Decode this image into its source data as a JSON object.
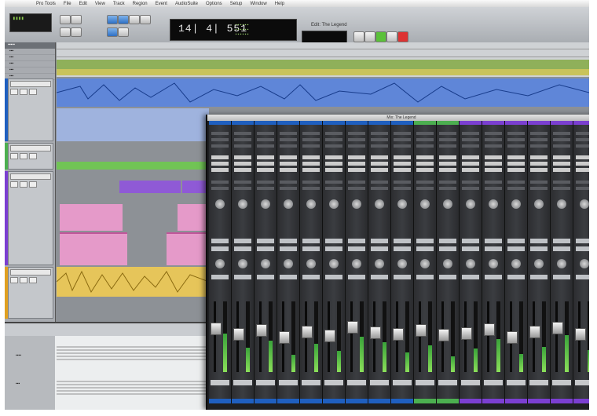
{
  "menu": [
    "Pro Tools",
    "File",
    "Edit",
    "View",
    "Track",
    "Region",
    "Event",
    "AudioSuite",
    "Options",
    "Setup",
    "Window",
    "Help"
  ],
  "toolbar": {
    "main_counter": "14| 4| 551",
    "window_title": "Edit: The Legend"
  },
  "mixer": {
    "title": "Mix: The Legend",
    "strips": [
      {
        "color": "#1f5fbf",
        "meter": 0.55,
        "fader": 0.62
      },
      {
        "color": "#1f5fbf",
        "meter": 0.35,
        "fader": 0.55
      },
      {
        "color": "#1f5fbf",
        "meter": 0.45,
        "fader": 0.6
      },
      {
        "color": "#1f5fbf",
        "meter": 0.25,
        "fader": 0.5
      },
      {
        "color": "#1f5fbf",
        "meter": 0.4,
        "fader": 0.58
      },
      {
        "color": "#1f5fbf",
        "meter": 0.3,
        "fader": 0.52
      },
      {
        "color": "#1f5fbf",
        "meter": 0.5,
        "fader": 0.64
      },
      {
        "color": "#1f5fbf",
        "meter": 0.42,
        "fader": 0.57
      },
      {
        "color": "#1f5fbf",
        "meter": 0.28,
        "fader": 0.55
      },
      {
        "color": "#4caf50",
        "meter": 0.38,
        "fader": 0.6
      },
      {
        "color": "#4caf50",
        "meter": 0.22,
        "fader": 0.53
      },
      {
        "color": "#7b3fd1",
        "meter": 0.33,
        "fader": 0.56
      },
      {
        "color": "#7b3fd1",
        "meter": 0.47,
        "fader": 0.61
      },
      {
        "color": "#7b3fd1",
        "meter": 0.26,
        "fader": 0.5
      },
      {
        "color": "#7b3fd1",
        "meter": 0.36,
        "fader": 0.58
      },
      {
        "color": "#7b3fd1",
        "meter": 0.52,
        "fader": 0.63
      },
      {
        "color": "#7b3fd1",
        "meter": 0.31,
        "fader": 0.55
      }
    ]
  },
  "colors": {
    "audio_region_blue": "#3f6fd1",
    "audio_region_yellow": "#e6c55a",
    "midi_region_pink": "#e59ac9",
    "midi_region_purple": "#8f5ad6",
    "green_region": "#71c455"
  }
}
